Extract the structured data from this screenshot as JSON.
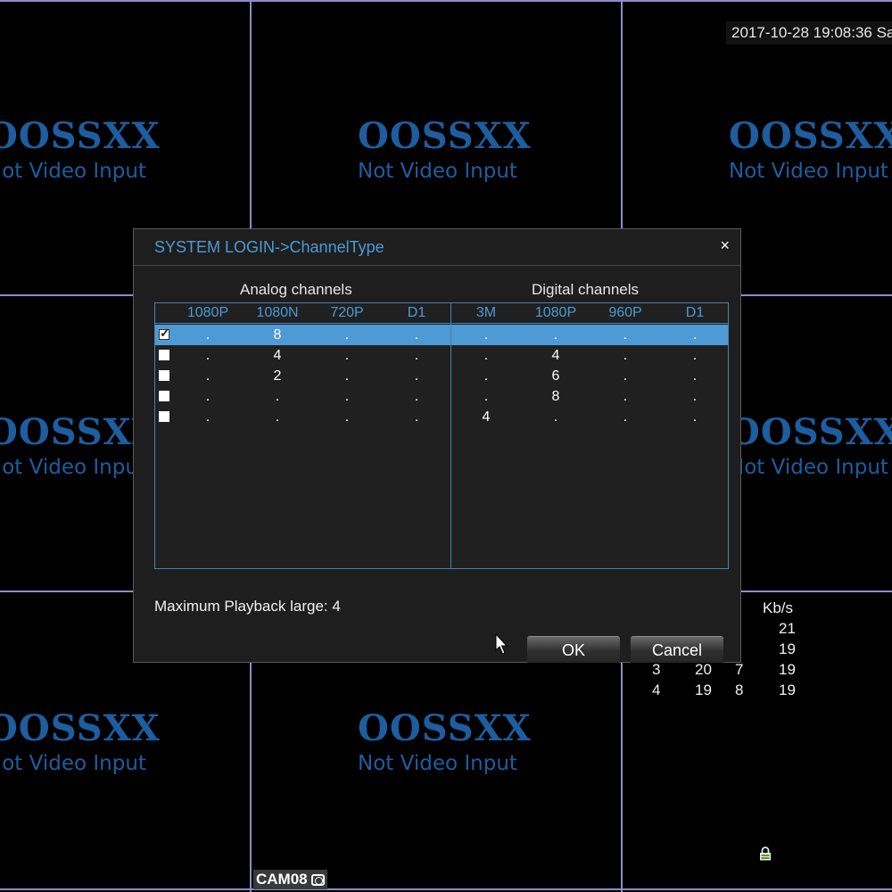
{
  "video_grid": {
    "channels": [
      {
        "brand": "OOSSXX",
        "status": "Not Video Input"
      },
      {
        "brand": "OOSSXX",
        "status": "Not Video Input"
      },
      {
        "brand": "OOSSXX",
        "status": "Not Video Input"
      },
      {
        "brand": "OOSSXX",
        "status": "Not Video Input"
      },
      {
        "brand": "OOSSXX",
        "status": "Not Video Input"
      },
      {
        "brand": "OOSSXX",
        "status": "Not Video Input"
      },
      {
        "brand": "OOSSXX",
        "status": "Not Video Input"
      },
      {
        "brand": "OOSSXX",
        "status": "Not Video Input"
      }
    ],
    "timestamp": "2017-10-28 19:08:36 Sa",
    "camera_label": "CAM08"
  },
  "bitrate_stats": {
    "header": "Kb/s",
    "rows": [
      [
        "",
        "",
        "",
        "21"
      ],
      [
        "",
        "",
        "",
        "19"
      ],
      [
        "3",
        "20",
        "7",
        "19"
      ],
      [
        "4",
        "19",
        "8",
        "19"
      ]
    ]
  },
  "dialog": {
    "title": "SYSTEM LOGIN->ChannelType",
    "close_label": "×",
    "analog": {
      "label": "Analog channels",
      "columns": [
        "1080P",
        "1080N",
        "720P",
        "D1"
      ],
      "rows": [
        {
          "checked": true,
          "values": [
            ".",
            "8",
            ".",
            "."
          ]
        },
        {
          "checked": false,
          "values": [
            ".",
            "4",
            ".",
            "."
          ]
        },
        {
          "checked": false,
          "values": [
            ".",
            "2",
            ".",
            "."
          ]
        },
        {
          "checked": false,
          "values": [
            ".",
            ".",
            ".",
            "."
          ]
        },
        {
          "checked": false,
          "values": [
            ".",
            ".",
            ".",
            "."
          ]
        }
      ]
    },
    "digital": {
      "label": "Digital channels",
      "columns": [
        "3M",
        "1080P",
        "960P",
        "D1"
      ],
      "rows": [
        {
          "values": [
            ".",
            ".",
            ".",
            "."
          ]
        },
        {
          "values": [
            ".",
            "4",
            ".",
            "."
          ]
        },
        {
          "values": [
            ".",
            "6",
            ".",
            "."
          ]
        },
        {
          "values": [
            ".",
            "8",
            ".",
            "."
          ]
        },
        {
          "values": [
            "4",
            ".",
            ".",
            "."
          ]
        }
      ]
    },
    "max_playback": "Maximum Playback large: 4",
    "ok_label": "OK",
    "cancel_label": "Cancel"
  },
  "colors": {
    "accent": "#4a9bd6",
    "selected_row": "#4e9ad6",
    "grid_line": "#8f8cc8",
    "brand": "#1d5da0"
  }
}
